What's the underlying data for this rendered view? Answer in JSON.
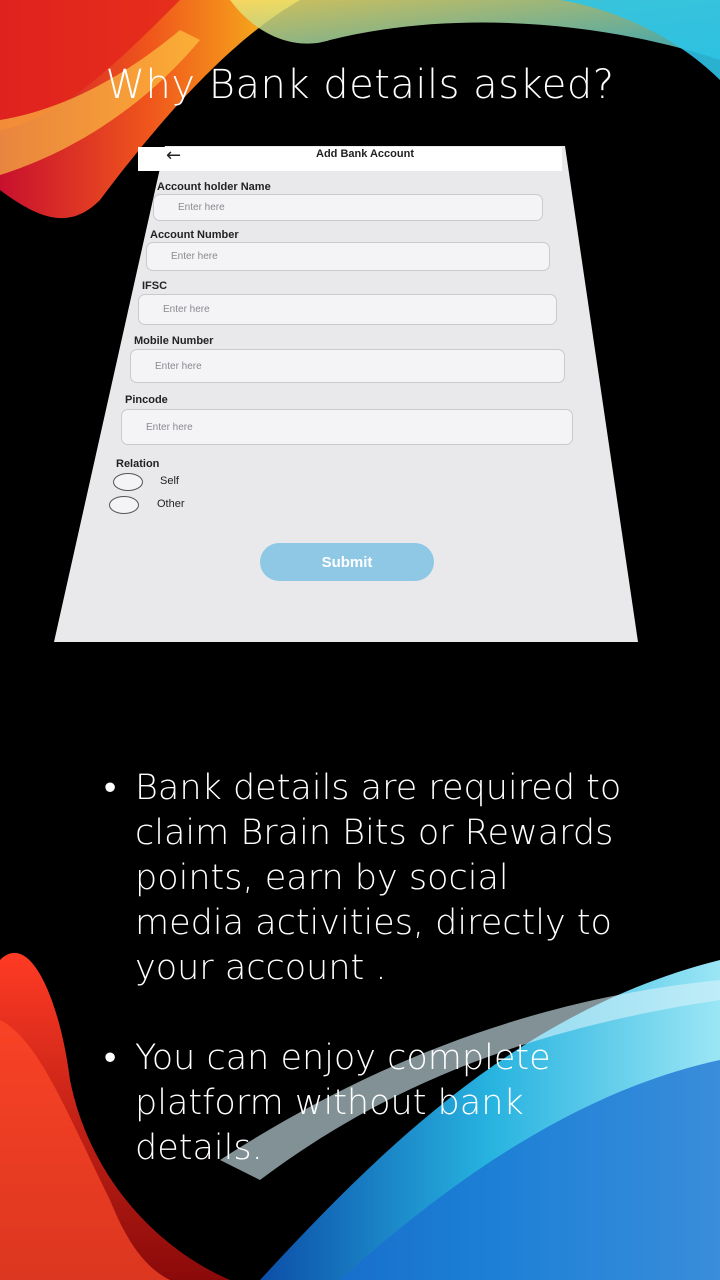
{
  "slide": {
    "title": "Why Bank details asked?"
  },
  "app_screen": {
    "back_icon": "←",
    "title": "Add Bank Account",
    "fields": [
      {
        "label": "Account holder Name",
        "placeholder": "Enter here"
      },
      {
        "label": "Account Number",
        "placeholder": "Enter here"
      },
      {
        "label": "IFSC",
        "placeholder": "Enter here"
      },
      {
        "label": "Mobile Number",
        "placeholder": "Enter here"
      },
      {
        "label": "Pincode",
        "placeholder": "Enter here"
      }
    ],
    "relation": {
      "label": "Relation",
      "options": [
        "Self",
        "Other"
      ]
    },
    "submit_label": "Submit",
    "submit_color": "#8ec8e5"
  },
  "bullets": [
    "Bank details are required to claim Brain Bits or Rewards points, earn by social media activities, directly to your account .",
    "You can enjoy complete platform without bank details."
  ],
  "bullet_glyph": "•",
  "colors": {
    "background": "#000000",
    "accent_red": "#e3261c",
    "accent_orange": "#f08a1c",
    "accent_cyan": "#2ec4e6",
    "accent_blue": "#1a6fd1"
  }
}
